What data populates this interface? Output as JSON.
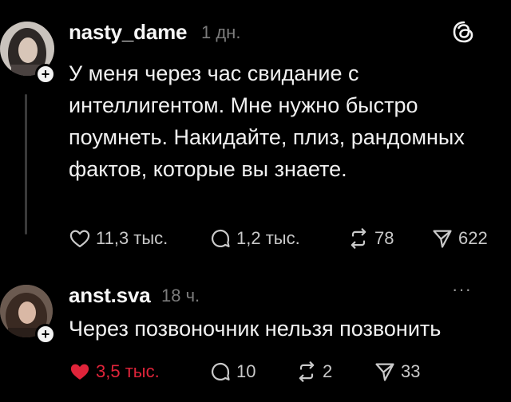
{
  "post": {
    "username": "nasty_dame",
    "time": "1 дн.",
    "text": "У меня через час свидание с интеллигентом. Мне нужно быстро поумнеть. Накидайте, плиз, рандомных фактов, которые вы знаете.",
    "likes": "11,3 тыс.",
    "replies": "1,2 тыс.",
    "reposts": "78",
    "shares": "622"
  },
  "reply": {
    "username": "anst.sva",
    "time": "18 ч.",
    "text": "Через позвоночник нельзя позвонить",
    "likes": "3,5 тыс.",
    "replies": "10",
    "reposts": "2",
    "shares": "33",
    "more": "···"
  },
  "icons": {
    "threads_logo": "threads-logo-icon",
    "like": "heart-icon",
    "reply": "comment-icon",
    "repost": "repost-icon",
    "share": "send-icon"
  },
  "colors": {
    "background": "#000000",
    "text": "#f1f1f1",
    "muted": "#7c7c7c",
    "liked": "#e0243a"
  }
}
